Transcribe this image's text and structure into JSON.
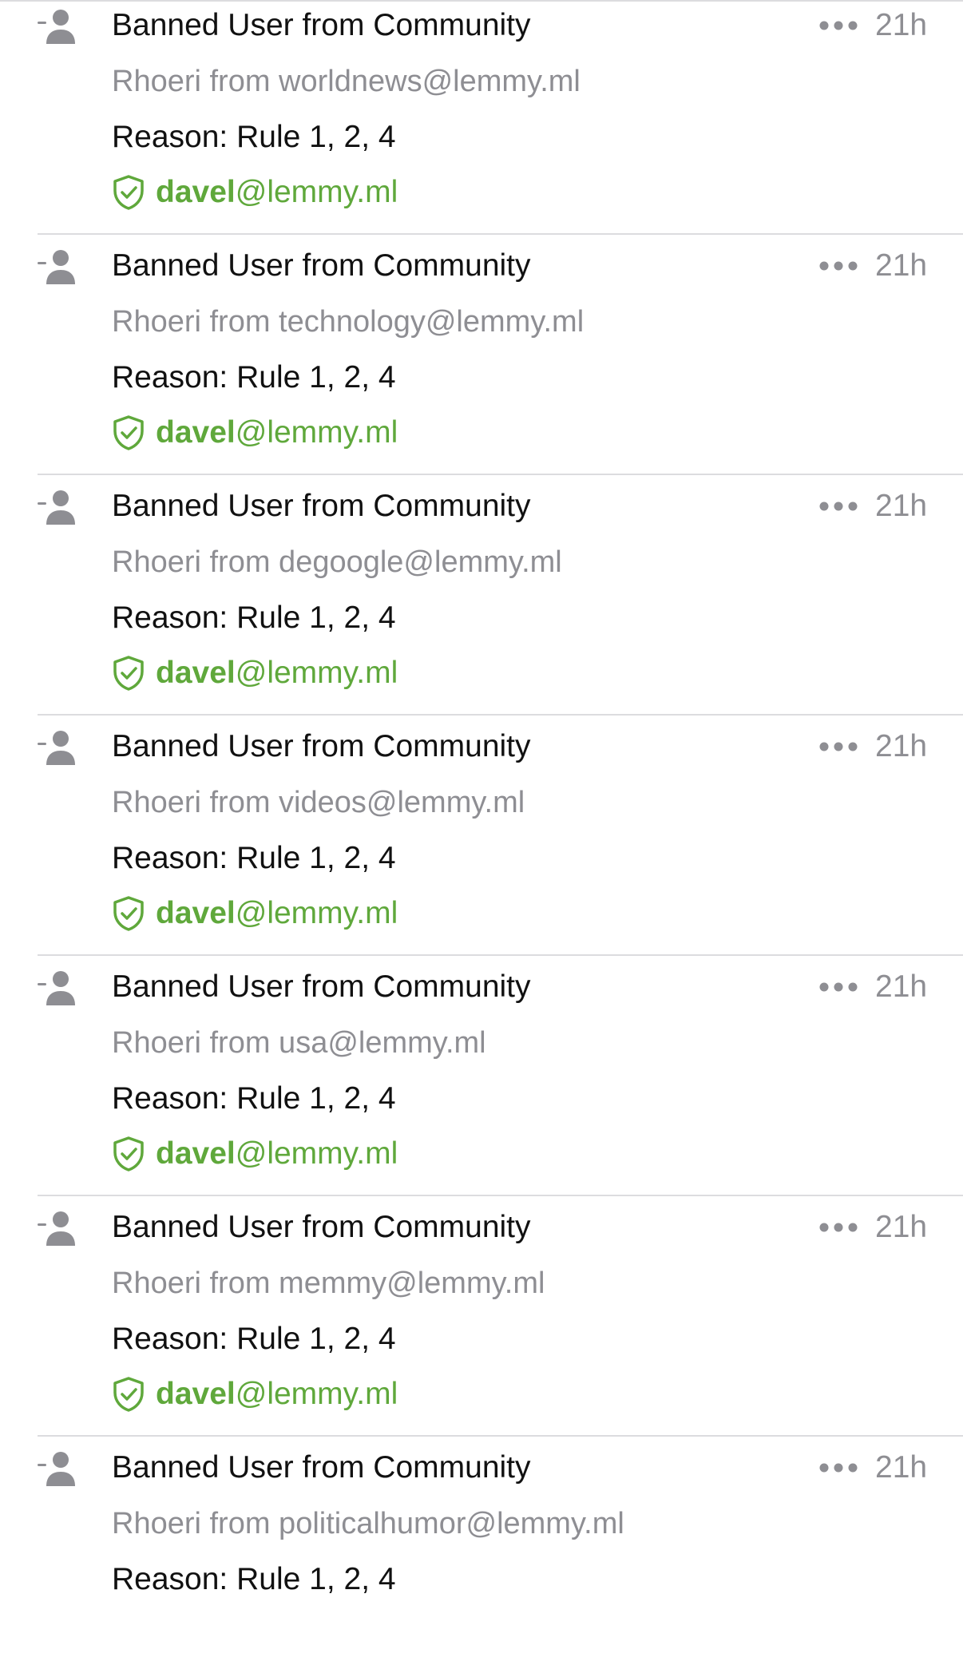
{
  "colors": {
    "moderator_green": "#5fa83b",
    "secondary_gray": "#8e8e93",
    "primary_text": "#111111",
    "separator": "#dcdcdf"
  },
  "icons": {
    "action": "person-minus-icon",
    "more": "ellipsis-icon",
    "moderator": "shield-check-icon"
  },
  "entries": [
    {
      "title": "Banned User from Community",
      "time": "21h",
      "subtitle": "Rhoeri from worldnews@lemmy.ml",
      "reason": "Reason: Rule 1, 2, 4",
      "moderator_name": "davel",
      "moderator_instance": "@lemmy.ml"
    },
    {
      "title": "Banned User from Community",
      "time": "21h",
      "subtitle": "Rhoeri from technology@lemmy.ml",
      "reason": "Reason: Rule 1, 2, 4",
      "moderator_name": "davel",
      "moderator_instance": "@lemmy.ml"
    },
    {
      "title": "Banned User from Community",
      "time": "21h",
      "subtitle": "Rhoeri from degoogle@lemmy.ml",
      "reason": "Reason: Rule 1, 2, 4",
      "moderator_name": "davel",
      "moderator_instance": "@lemmy.ml"
    },
    {
      "title": "Banned User from Community",
      "time": "21h",
      "subtitle": "Rhoeri from videos@lemmy.ml",
      "reason": "Reason: Rule 1, 2, 4",
      "moderator_name": "davel",
      "moderator_instance": "@lemmy.ml"
    },
    {
      "title": "Banned User from Community",
      "time": "21h",
      "subtitle": "Rhoeri from usa@lemmy.ml",
      "reason": "Reason: Rule 1, 2, 4",
      "moderator_name": "davel",
      "moderator_instance": "@lemmy.ml"
    },
    {
      "title": "Banned User from Community",
      "time": "21h",
      "subtitle": "Rhoeri from memmy@lemmy.ml",
      "reason": "Reason: Rule 1, 2, 4",
      "moderator_name": "davel",
      "moderator_instance": "@lemmy.ml"
    },
    {
      "title": "Banned User from Community",
      "time": "21h",
      "subtitle": "Rhoeri from politicalhumor@lemmy.ml",
      "reason": "Reason: Rule 1, 2, 4"
    }
  ]
}
